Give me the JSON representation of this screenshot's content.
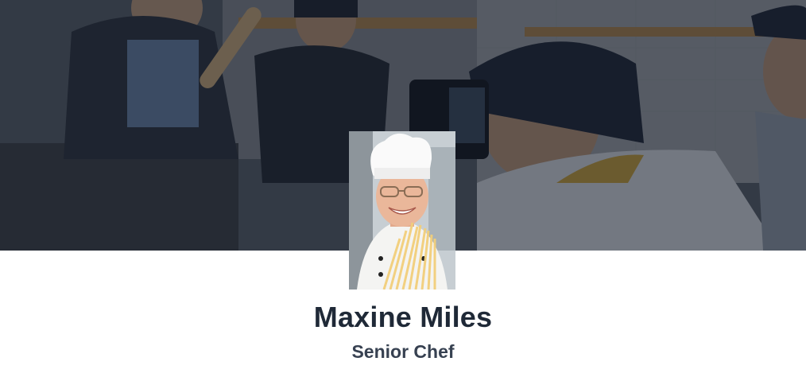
{
  "profile": {
    "name": "Maxine Miles",
    "title": "Senior Chef"
  },
  "cover": {
    "icon": "kitchen-photo"
  },
  "avatar": {
    "icon": "chef-portrait"
  },
  "colors": {
    "name_text": "#1f2937",
    "title_text": "#374151",
    "overlay": "#141c2a"
  }
}
